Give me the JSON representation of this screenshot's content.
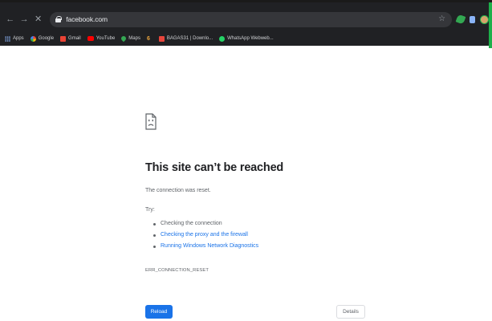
{
  "browser": {
    "url": "facebook.com",
    "nav": {
      "back_icon": "←",
      "forward_icon": "→",
      "stop_icon": "✕"
    },
    "star_icon": "☆",
    "bookmarks": [
      {
        "label": "Apps",
        "icon": "apps-grid-icon"
      },
      {
        "label": "Google",
        "icon": "google-icon"
      },
      {
        "label": "Gmail",
        "icon": "gmail-icon"
      },
      {
        "label": "YouTube",
        "icon": "youtube-icon"
      },
      {
        "label": "Maps",
        "icon": "maps-icon"
      },
      {
        "label": "",
        "icon": "six-icon",
        "glyph": "6"
      },
      {
        "label": "BAGAS31 | Downlo...",
        "icon": "bagas-icon"
      },
      {
        "label": "WhatsApp Webweb...",
        "icon": "whatsapp-icon"
      }
    ]
  },
  "error_page": {
    "title": "This site can’t be reached",
    "description": "The connection was reset.",
    "try_label": "Try:",
    "suggestions": [
      {
        "text": "Checking the connection",
        "is_link": false
      },
      {
        "text": "Checking the proxy and the firewall",
        "is_link": true
      },
      {
        "text": "Running Windows Network Diagnostics",
        "is_link": true
      }
    ],
    "error_code": "ERR_CONNECTION_RESET",
    "reload_label": "Reload",
    "details_label": "Details"
  },
  "colors": {
    "chrome_bg": "#202124",
    "accent_green": "#1db04a",
    "link_blue": "#1a73e8",
    "text_gray": "#5f6368",
    "title_dark": "#202124"
  }
}
